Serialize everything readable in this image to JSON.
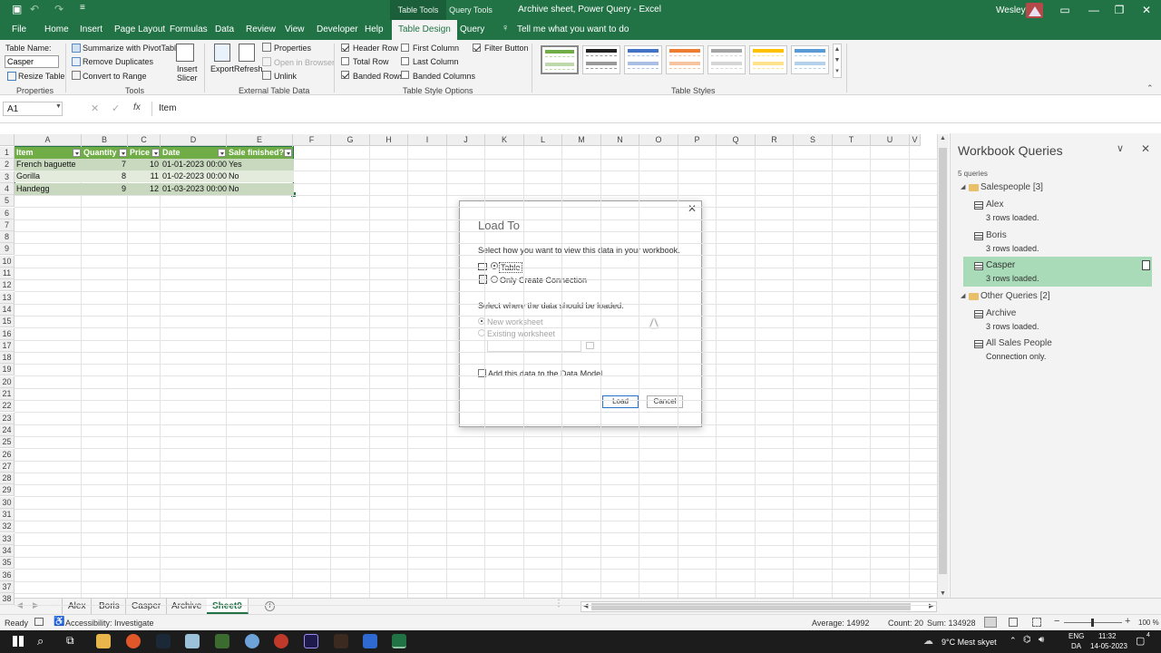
{
  "app": {
    "document_title": "Archive sheet, Power Query  -  Excel",
    "user": "Wesley",
    "context_table_tools": "Table Tools",
    "context_query_tools": "Query Tools"
  },
  "ribbon_tabs": [
    "File",
    "Home",
    "Insert",
    "Page Layout",
    "Formulas",
    "Data",
    "Review",
    "View",
    "Developer",
    "Help",
    "Table Design",
    "Query"
  ],
  "tell_me": "Tell me what you want to do",
  "ribbon": {
    "table_name_label": "Table Name:",
    "table_name_value": "Casper",
    "resize_table": "Resize Table",
    "group_properties": "Properties",
    "summarize": "Summarize with PivotTable",
    "remove_duplicates": "Remove Duplicates",
    "convert_to_range": "Convert to Range",
    "group_tools": "Tools",
    "insert_slicer_1": "Insert",
    "insert_slicer_2": "Slicer",
    "export": "Export",
    "refresh": "Refresh",
    "properties": "Properties",
    "open_in_browser": "Open in Browser",
    "unlink": "Unlink",
    "group_external": "External Table Data",
    "header_row": "Header Row",
    "total_row": "Total Row",
    "banded_rows": "Banded Rows",
    "first_column": "First Column",
    "last_column": "Last Column",
    "banded_columns": "Banded Columns",
    "filter_button": "Filter Button",
    "group_style_options": "Table Style Options",
    "group_table_styles": "Table Styles",
    "style_colors": [
      "#70ad47",
      "#222222",
      "#4472c4",
      "#ed7d31",
      "#a5a5a5",
      "#ffc000",
      "#5b9bd5"
    ]
  },
  "formula_bar": {
    "name_box": "A1",
    "fx": "fx",
    "content": "Item"
  },
  "columns": [
    "A",
    "B",
    "C",
    "D",
    "E",
    "F",
    "G",
    "H",
    "I",
    "J",
    "K",
    "L",
    "M",
    "N",
    "O",
    "P",
    "Q",
    "R",
    "S",
    "T",
    "U",
    "V"
  ],
  "rows": [
    "1",
    "2",
    "3",
    "4",
    "5",
    "6",
    "7",
    "8",
    "9",
    "10",
    "11",
    "12",
    "13",
    "14",
    "15",
    "16",
    "17",
    "18",
    "19",
    "20",
    "21",
    "22",
    "23",
    "24",
    "25",
    "26",
    "27",
    "28",
    "29",
    "30",
    "31",
    "32",
    "33",
    "34",
    "35",
    "36",
    "37",
    "38"
  ],
  "table": {
    "headers": [
      "Item",
      "Quantity",
      "Price",
      "Date",
      "Sale finished?"
    ],
    "rows": [
      [
        "French baguette",
        "7",
        "10",
        "01-01-2023 00:00",
        "Yes"
      ],
      [
        "Gorilla",
        "8",
        "11",
        "01-02-2023 00:00",
        "No"
      ],
      [
        "Handegg",
        "9",
        "12",
        "01-03-2023 00:00",
        "No"
      ]
    ]
  },
  "queries_pane": {
    "title": "Workbook Queries",
    "count": "5 queries",
    "groups": [
      {
        "name": "Salespeople [3]",
        "items": [
          {
            "name": "Alex",
            "status": "3 rows loaded."
          },
          {
            "name": "Boris",
            "status": "3 rows loaded."
          },
          {
            "name": "Casper",
            "status": "3 rows loaded."
          }
        ]
      },
      {
        "name": "Other Queries [2]",
        "items": [
          {
            "name": "Archive",
            "status": "3 rows loaded."
          },
          {
            "name": "All Sales People",
            "status": "Connection only."
          }
        ]
      }
    ]
  },
  "dialog": {
    "title": "Load To",
    "prompt_view": "Select how you want to view this data in your workbook.",
    "opt_table": "Table",
    "opt_connection": "Only Create Connection",
    "prompt_where": "Select where the data should be loaded.",
    "opt_new_ws": "New worksheet",
    "opt_existing_ws": "Existing worksheet",
    "data_model": "Add this data to the Data Model",
    "load": "Load",
    "cancel": "Cancel"
  },
  "sheets": [
    "Alex",
    "Boris",
    "Casper",
    "Archive",
    "Sheet9"
  ],
  "status": {
    "ready": "Ready",
    "accessibility": "Accessibility: Investigate",
    "average": "Average: 14992",
    "count": "Count: 20",
    "sum": "Sum: 134928",
    "zoom": "100 %"
  },
  "taskbar": {
    "weather": "9°C  Mest skyet",
    "lang1": "ENG",
    "lang2": "DA",
    "time": "11:32",
    "date": "14-05-2023",
    "notif": "4"
  }
}
